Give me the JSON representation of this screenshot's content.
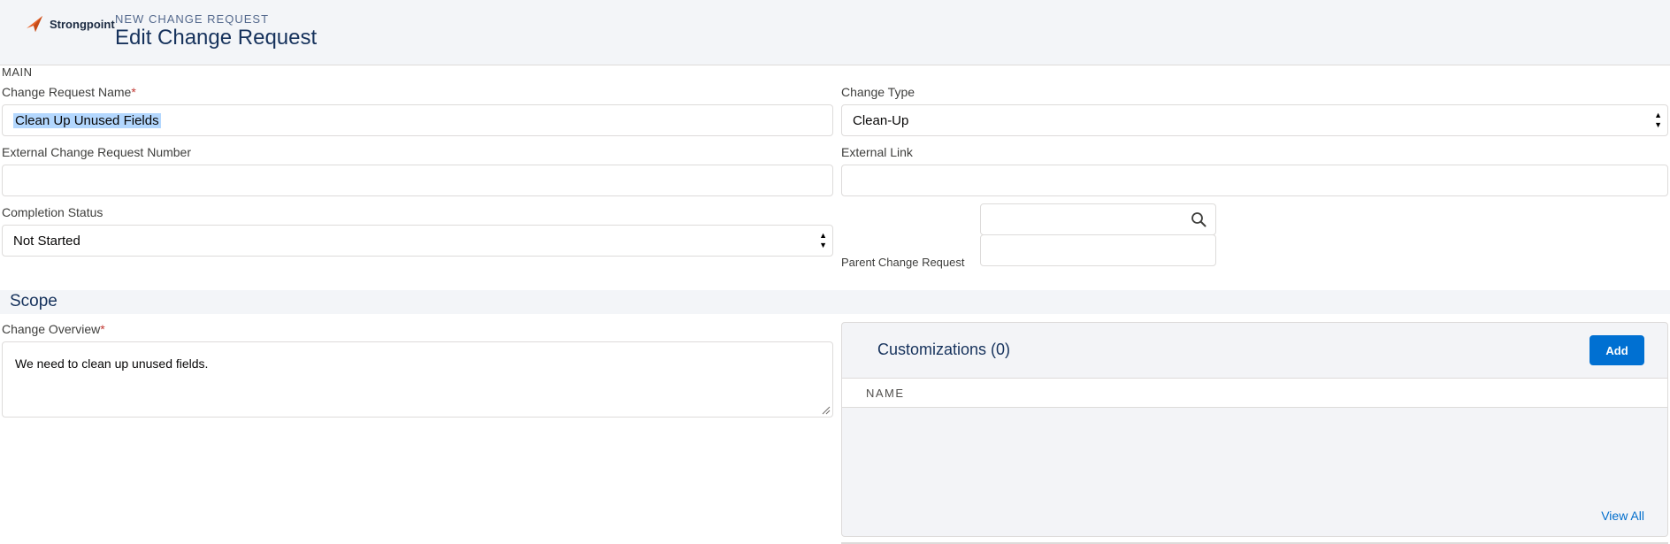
{
  "header": {
    "logo_text": "Strongpoint",
    "eyebrow": "NEW CHANGE REQUEST",
    "title": "Edit Change Request"
  },
  "main": {
    "section_label": "MAIN",
    "change_request_name": {
      "label": "Change Request Name",
      "required_mark": "*",
      "value": "Clean Up Unused Fields"
    },
    "change_type": {
      "label": "Change Type",
      "value": "Clean-Up"
    },
    "external_number": {
      "label": "External Change Request Number",
      "value": ""
    },
    "external_link": {
      "label": "External Link",
      "value": ""
    },
    "completion_status": {
      "label": "Completion Status",
      "value": "Not Started"
    },
    "parent_change_request": {
      "label": "Parent Change Request",
      "value": ""
    }
  },
  "scope": {
    "title": "Scope",
    "change_overview": {
      "label": "Change Overview",
      "required_mark": "*",
      "value": "We need to clean up unused fields."
    }
  },
  "customizations": {
    "title": "Customizations (0)",
    "add_label": "Add",
    "column_name": "NAME",
    "view_all": "View All"
  },
  "colors": {
    "accent": "#0070d2",
    "required": "#c23934",
    "logo": "#e8642c"
  },
  "icons": [
    "strongpoint-logo-icon",
    "search-icon",
    "select-arrows-icon",
    "resize-grip-icon"
  ]
}
